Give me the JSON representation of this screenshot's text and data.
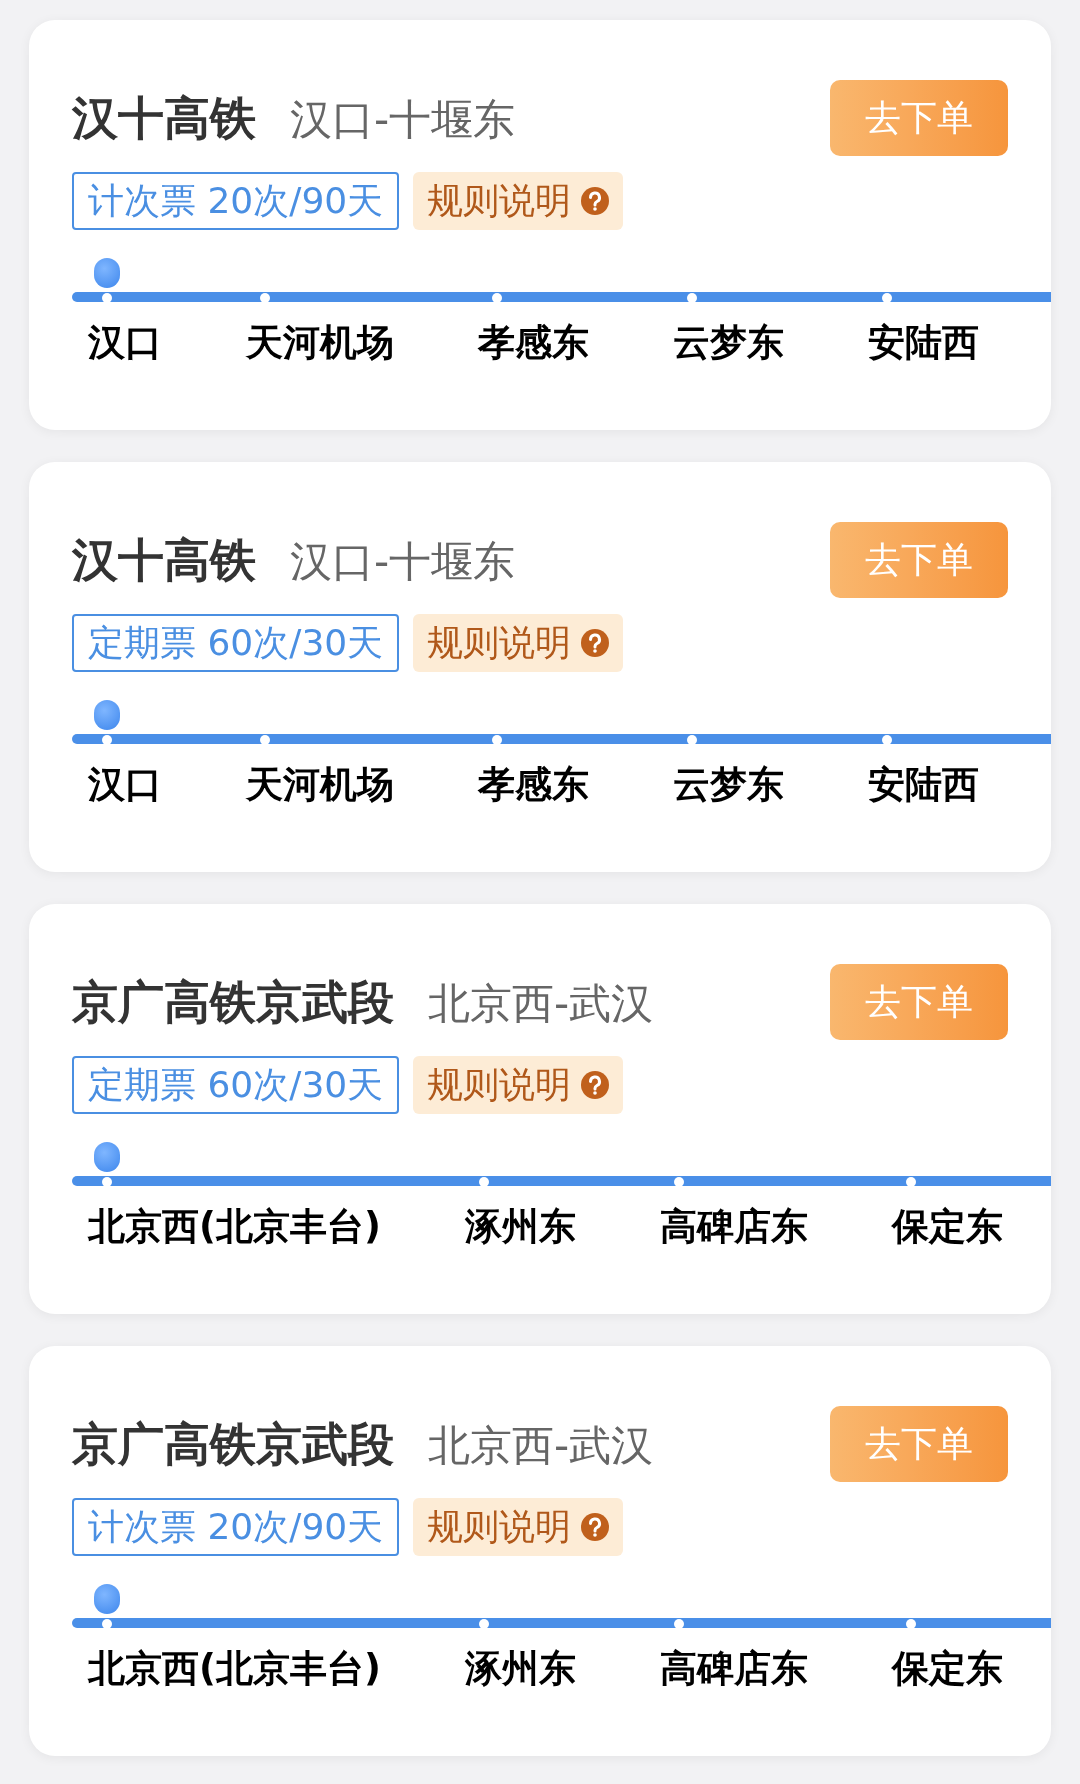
{
  "cards": [
    {
      "line": "汉十高铁",
      "route": "汉口-十堰东",
      "button": "去下单",
      "ticket": "计次票 20次/90天",
      "rules": "规则说明",
      "stations": [
        {
          "name": "汉口",
          "current": true
        },
        {
          "name": "天河机场",
          "current": false
        },
        {
          "name": "孝感东",
          "current": false
        },
        {
          "name": "云梦东",
          "current": false
        },
        {
          "name": "安陆西",
          "current": false
        }
      ]
    },
    {
      "line": "汉十高铁",
      "route": "汉口-十堰东",
      "button": "去下单",
      "ticket": "定期票 60次/30天",
      "rules": "规则说明",
      "stations": [
        {
          "name": "汉口",
          "current": true
        },
        {
          "name": "天河机场",
          "current": false
        },
        {
          "name": "孝感东",
          "current": false
        },
        {
          "name": "云梦东",
          "current": false
        },
        {
          "name": "安陆西",
          "current": false
        }
      ]
    },
    {
      "line": "京广高铁京武段",
      "route": "北京西-武汉",
      "button": "去下单",
      "ticket": "定期票 60次/30天",
      "rules": "规则说明",
      "stations": [
        {
          "name": "北京西(北京丰台)",
          "current": true
        },
        {
          "name": "涿州东",
          "current": false
        },
        {
          "name": "高碑店东",
          "current": false
        },
        {
          "name": "保定东",
          "current": false
        }
      ]
    },
    {
      "line": "京广高铁京武段",
      "route": "北京西-武汉",
      "button": "去下单",
      "ticket": "计次票 20次/90天",
      "rules": "规则说明",
      "stations": [
        {
          "name": "北京西(北京丰台)",
          "current": true
        },
        {
          "name": "涿州东",
          "current": false
        },
        {
          "name": "高碑店东",
          "current": false
        },
        {
          "name": "保定东",
          "current": false
        }
      ]
    }
  ]
}
